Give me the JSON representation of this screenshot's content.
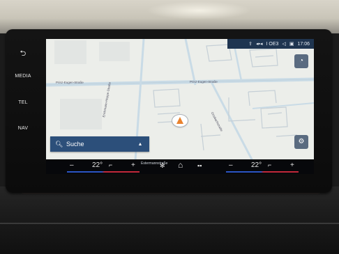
{
  "hardkeys": {
    "back_glyph": "⮌",
    "media": "MEDIA",
    "tel": "TEL",
    "nav": "NAV"
  },
  "status_bar": {
    "phone_glyph": "⇪",
    "signal": "◂▪◂",
    "operator": "I OE3",
    "volume_glyph": "◁",
    "screen_glyph": "▣",
    "time": "17:06"
  },
  "map": {
    "streets": {
      "prinz_eugen_left": "Prinz-Eugen-Straße",
      "prinz_eugen_right": "Prinz-Eugen-Straße",
      "diagonal_left": "Erichmann-Heppe-Straße",
      "diagonal_right": "Ortsbachstraße",
      "estermann": "Estermannstraße"
    },
    "compass_glyph": "◔",
    "settings_glyph": "⚙"
  },
  "search": {
    "label": "Suche",
    "icon": "search-icon",
    "expand_glyph": "▲"
  },
  "climate": {
    "minus": "–",
    "plus": "+",
    "left_temp": "22°",
    "right_temp": "22°",
    "seat_glyph": "⌐",
    "fan_glyph": "✻",
    "home_glyph": "⌂",
    "apps_glyph": "▪▪"
  },
  "colors": {
    "status_bar": "#1f3550",
    "search_bar": "#2c4f7a",
    "car_arrow": "#e9822e",
    "temp_cold": "#2b55c4",
    "temp_warm": "#c3283a"
  }
}
